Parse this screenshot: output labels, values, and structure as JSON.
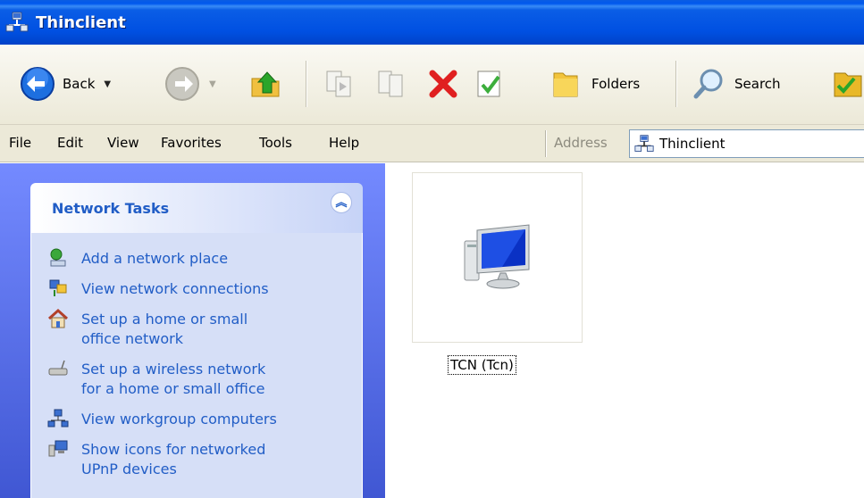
{
  "window": {
    "title": "Thinclient"
  },
  "toolbar": {
    "back_label": "Back",
    "folders_label": "Folders",
    "search_label": "Search"
  },
  "menu": {
    "file": "File",
    "edit": "Edit",
    "view": "View",
    "favorites": "Favorites",
    "tools": "Tools",
    "help": "Help"
  },
  "address": {
    "label": "Address",
    "value": "Thinclient"
  },
  "tasks": {
    "title": "Network Tasks",
    "items": [
      {
        "label": "Add a network place",
        "icon": "add-network-place-icon"
      },
      {
        "label": "View network connections",
        "icon": "network-connections-icon"
      },
      {
        "label": "Set up a home or small\noffice network",
        "icon": "home-network-icon"
      },
      {
        "label": "Set up a wireless network\nfor a home or small office",
        "icon": "wireless-network-icon"
      },
      {
        "label": "View workgroup computers",
        "icon": "workgroup-computers-icon"
      },
      {
        "label": "Show icons for networked\nUPnP devices",
        "icon": "upnp-devices-icon"
      }
    ]
  },
  "content": {
    "items": [
      {
        "label": "TCN (Tcn)",
        "icon": "computer-icon"
      }
    ]
  },
  "colors": {
    "titlebar": "#0050e2",
    "task_link": "#215dc6",
    "pane_bg": "#6a82f0",
    "task_body": "#d6dff7"
  }
}
